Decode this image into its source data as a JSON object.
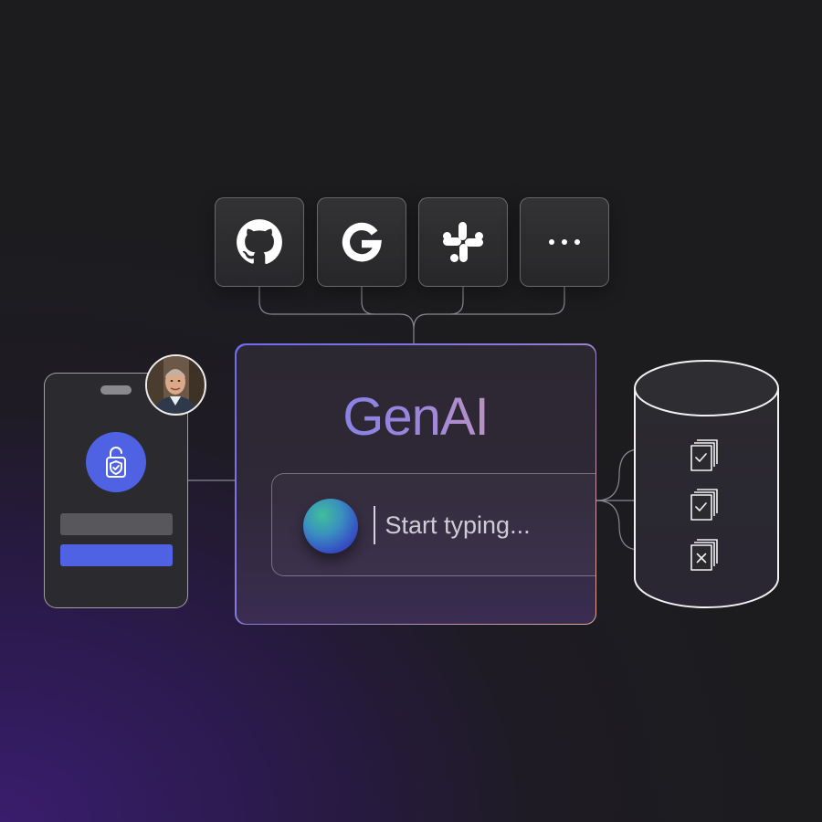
{
  "integrations": [
    {
      "name": "GitHub",
      "icon": "github-icon"
    },
    {
      "name": "Google",
      "icon": "google-icon"
    },
    {
      "name": "Slack",
      "icon": "slack-icon"
    },
    {
      "name": "More",
      "icon": "more-icon"
    }
  ],
  "genai": {
    "title": "GenAI",
    "prompt_placeholder": "Start typing..."
  },
  "phone": {
    "icon": "shield-unlock-icon",
    "user_avatar": "user-avatar"
  },
  "database": {
    "documents": [
      {
        "status": "approved",
        "icon": "document-check-icon"
      },
      {
        "status": "approved",
        "icon": "document-check-icon"
      },
      {
        "status": "rejected",
        "icon": "document-x-icon"
      }
    ]
  },
  "colors": {
    "accent_blue": "#4f62e3",
    "gradient_start": "#6d7bf0",
    "gradient_end": "#e7a49a",
    "background": "#1c1c1e"
  }
}
